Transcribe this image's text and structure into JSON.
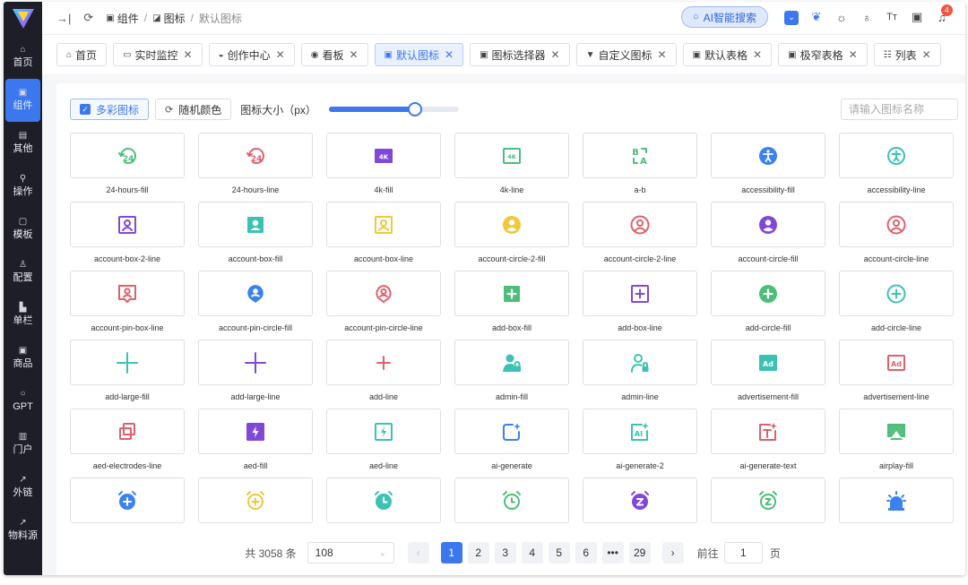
{
  "sidebar": {
    "items": [
      {
        "label": "首页",
        "icon": "home-icon",
        "glyph": "⌂"
      },
      {
        "label": "组件",
        "icon": "component-icon",
        "glyph": "▣",
        "active": true
      },
      {
        "label": "其他",
        "icon": "other-icon",
        "glyph": "▤"
      },
      {
        "label": "操作",
        "icon": "operation-icon",
        "glyph": "⚲"
      },
      {
        "label": "模板",
        "icon": "template-icon",
        "glyph": "▢"
      },
      {
        "label": "配置",
        "icon": "config-icon",
        "glyph": "♙"
      },
      {
        "label": "单栏",
        "icon": "single-column-icon",
        "glyph": "▙"
      },
      {
        "label": "商品",
        "icon": "goods-icon",
        "glyph": "▣"
      },
      {
        "label": "GPT",
        "icon": "gpt-icon",
        "glyph": "○"
      },
      {
        "label": "门户",
        "icon": "portal-icon",
        "glyph": "▥"
      },
      {
        "label": "外链",
        "icon": "external-link-icon",
        "glyph": "↗"
      },
      {
        "label": "物料源",
        "icon": "material-source-icon",
        "glyph": "↗"
      }
    ]
  },
  "header": {
    "breadcrumb": [
      "组件",
      "图标",
      "默认图标"
    ],
    "ai_search": "AI智能搜索",
    "notify_count": "4"
  },
  "tabs": [
    {
      "label": "首页",
      "glyph": "⌂",
      "closable": false
    },
    {
      "label": "实时监控",
      "glyph": "▭",
      "closable": true
    },
    {
      "label": "创作中心",
      "glyph": "◒",
      "closable": true
    },
    {
      "label": "看板",
      "glyph": "◉",
      "closable": true
    },
    {
      "label": "默认图标",
      "glyph": "▣",
      "closable": true,
      "active": true
    },
    {
      "label": "图标选择器",
      "glyph": "▣",
      "closable": true
    },
    {
      "label": "自定义图标",
      "glyph": "▼",
      "closable": true
    },
    {
      "label": "默认表格",
      "glyph": "▣",
      "closable": true
    },
    {
      "label": "极窄表格",
      "glyph": "▣",
      "closable": true
    },
    {
      "label": "列表",
      "glyph": "☷",
      "closable": true
    }
  ],
  "toolbar": {
    "multicolor_label": "多彩图标",
    "random_color_label": "随机颜色",
    "size_label": "图标大小（px）",
    "size_level": 0.66,
    "search_placeholder": "请输入图标名称"
  },
  "icons": [
    {
      "name": "24-hours-fill",
      "color": "#4dbd7a",
      "shape": "hours24"
    },
    {
      "name": "24-hours-line",
      "color": "#e05f6b",
      "shape": "hours24"
    },
    {
      "name": "4k-fill",
      "color": "#8148d8",
      "shape": "k4fill"
    },
    {
      "name": "4k-line",
      "color": "#4dbd7a",
      "shape": "k4line"
    },
    {
      "name": "a-b",
      "color": "#4dbd7a",
      "shape": "ab"
    },
    {
      "name": "accessibility-fill",
      "color": "#3b82f0",
      "shape": "access-fill"
    },
    {
      "name": "accessibility-line",
      "color": "#3cc2b4",
      "shape": "access-line"
    },
    {
      "name": "account-box-2-line",
      "color": "#8148d8",
      "shape": "accbox-line"
    },
    {
      "name": "account-box-fill",
      "color": "#3cc2b4",
      "shape": "accbox-fill"
    },
    {
      "name": "account-box-line",
      "color": "#f0c83c",
      "shape": "accbox-line"
    },
    {
      "name": "account-circle-2-fill",
      "color": "#f0c83c",
      "shape": "acccircle-fill"
    },
    {
      "name": "account-circle-2-line",
      "color": "#e05f6b",
      "shape": "acccircle-line"
    },
    {
      "name": "account-circle-fill",
      "color": "#8148d8",
      "shape": "acccircle-fill"
    },
    {
      "name": "account-circle-line",
      "color": "#e05f6b",
      "shape": "acccircle-line"
    },
    {
      "name": "account-pin-box-line",
      "color": "#e05f6b",
      "shape": "pinbox-line"
    },
    {
      "name": "account-pin-circle-fill",
      "color": "#3b82f0",
      "shape": "pincircle-fill"
    },
    {
      "name": "account-pin-circle-line",
      "color": "#e05f6b",
      "shape": "pincircle-line"
    },
    {
      "name": "add-box-fill",
      "color": "#4dbd7a",
      "shape": "addbox-fill"
    },
    {
      "name": "add-box-line",
      "color": "#8148d8",
      "shape": "addbox-line"
    },
    {
      "name": "add-circle-fill",
      "color": "#4dbd7a",
      "shape": "addcircle-fill"
    },
    {
      "name": "add-circle-line",
      "color": "#3cc2b4",
      "shape": "addcircle-line"
    },
    {
      "name": "add-large-fill",
      "color": "#3cc2b4",
      "shape": "add-large"
    },
    {
      "name": "add-large-line",
      "color": "#8148d8",
      "shape": "add-large"
    },
    {
      "name": "add-line",
      "color": "#e05f6b",
      "shape": "add-small"
    },
    {
      "name": "admin-fill",
      "color": "#3cc2b4",
      "shape": "admin-fill"
    },
    {
      "name": "admin-line",
      "color": "#3cc2b4",
      "shape": "admin-line"
    },
    {
      "name": "advertisement-fill",
      "color": "#3cc2b4",
      "shape": "ad-fill"
    },
    {
      "name": "advertisement-line",
      "color": "#e05f6b",
      "shape": "ad-line"
    },
    {
      "name": "aed-electrodes-line",
      "color": "#e05f6b",
      "shape": "aed-electrodes"
    },
    {
      "name": "aed-fill",
      "color": "#8148d8",
      "shape": "aed-fill"
    },
    {
      "name": "aed-line",
      "color": "#3cc2b4",
      "shape": "aed-line"
    },
    {
      "name": "ai-generate",
      "color": "#3b82f0",
      "shape": "ai-generate"
    },
    {
      "name": "ai-generate-2",
      "color": "#3cc2b4",
      "shape": "ai-generate-2"
    },
    {
      "name": "ai-generate-text",
      "color": "#e05f6b",
      "shape": "ai-generate-text"
    },
    {
      "name": "airplay-fill",
      "color": "#4dbd7a",
      "shape": "airplay"
    },
    {
      "name": "",
      "color": "#3b82f0",
      "shape": "alarm-add-fill"
    },
    {
      "name": "",
      "color": "#f0c83c",
      "shape": "alarm-add-line"
    },
    {
      "name": "",
      "color": "#3cc2b4",
      "shape": "alarm-fill"
    },
    {
      "name": "",
      "color": "#4dbd7a",
      "shape": "alarm-line"
    },
    {
      "name": "",
      "color": "#8148d8",
      "shape": "alarm-snooze-fill"
    },
    {
      "name": "",
      "color": "#4dbd7a",
      "shape": "alarm-snooze-line"
    },
    {
      "name": "",
      "color": "#3b82f0",
      "shape": "alarm-warning"
    }
  ],
  "pagination": {
    "total_text": "共 3058 条",
    "page_size": "108",
    "pages": [
      "1",
      "2",
      "3",
      "4",
      "5",
      "6",
      "•••",
      "29"
    ],
    "current": "1",
    "prev": "‹",
    "next": "›",
    "goto_label": "前往",
    "goto_value": "1",
    "goto_suffix": "页"
  }
}
